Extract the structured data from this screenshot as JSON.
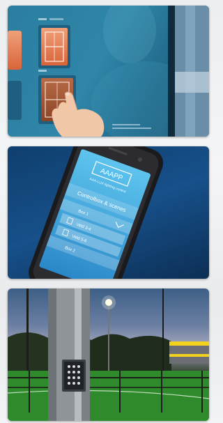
{
  "panel_touchscreen": {
    "tiles": [
      "court-tile",
      "court-tile",
      "court-tile",
      "court-tile-active"
    ],
    "hand": "pointing-hand"
  },
  "panel_app": {
    "app_logo_text": "AAAPP",
    "app_subtitle": "AAA-LUX lighting control",
    "section_title": "Controlbox & scenes",
    "rows": [
      {
        "label": "Box 1"
      },
      {
        "label": "Veld 3-4"
      },
      {
        "label": "Veld 5-6"
      },
      {
        "label": "Box 2"
      }
    ]
  },
  "panel_keypad": {
    "scene": "lamp-pole-with-keypad"
  }
}
